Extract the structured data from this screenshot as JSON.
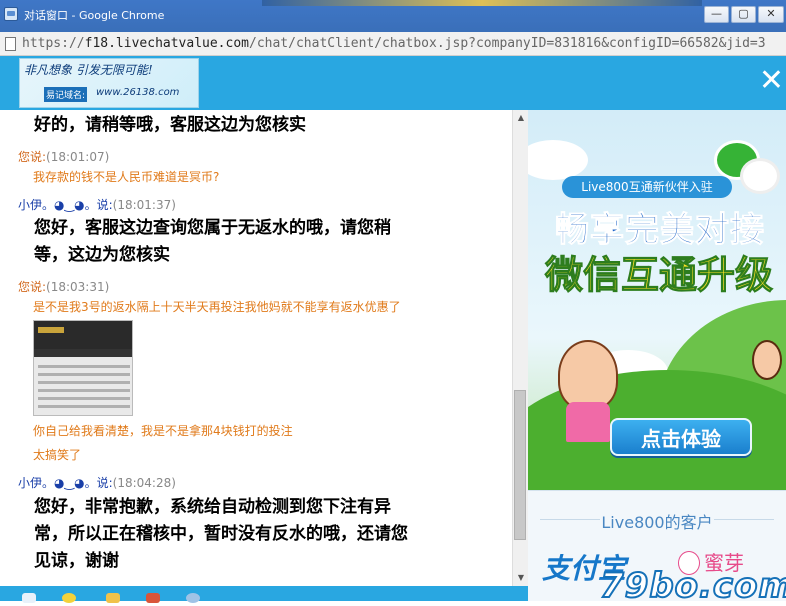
{
  "window": {
    "title": "对话窗口 - Google Chrome",
    "controls": {
      "minimize": "—",
      "maximize": "▢",
      "close": "✕"
    }
  },
  "address": {
    "url_prefix": "https://",
    "url_host": "f18.livechatvalue.com",
    "url_rest": "/chat/chatClient/chatbox.jsp?companyID=831816&configID=66582&jid=3"
  },
  "header": {
    "logo_slogan": "非凡想象  引发无限可能!",
    "logo_domain_label": "易记域名:",
    "logo_domain": "www.26138.com",
    "close_glyph": "✕"
  },
  "messages": {
    "m1_text": "好的，请稍等哦，客服这边为您核实",
    "m2_sender": "您说:",
    "m2_time": "(18:01:07)",
    "m2_text": "我存款的钱不是人民币难道是冥币?",
    "m3_sender": "小伊。◕‿◕。说:",
    "m3_time": "(18:01:37)",
    "m3_text_line1": "您好，客服这边查询您属于无返水的哦，请您稍",
    "m3_text_line2": "等，这边为您核实",
    "m4_sender": "您说:",
    "m4_time": "(18:03:31)",
    "m4_text": "是不是我3号的返水隔上十天半天再投注我他妈就不能享有返水优惠了",
    "m4_text2": "你自己给我看清楚，我是不是拿那4块钱打的投注",
    "m4_text3": "太搞笑了",
    "m5_sender": "小伊。◕‿◕。说:",
    "m5_time": "(18:04:28)",
    "m5_text_line1": "您好，非常抱歉，系统给自动检测到您下注有异",
    "m5_text_line2": "常，所以正在稽核中，暂时没有反水的哦，还请您",
    "m5_text_line3": "见谅，谢谢"
  },
  "scrollbar": {
    "up": "▲",
    "down": "▼"
  },
  "ad": {
    "badge": "Live800互通新伙伴入驻",
    "headline1": "畅享完美对接",
    "headline2": "微信互通升级",
    "cta": "点击体验"
  },
  "clients": {
    "title": "Live800的客户",
    "alipay": "支付宝",
    "miya": "蜜芽"
  },
  "watermark": "79bo.com",
  "colors": {
    "header_blue": "#29a7e1",
    "user_orange": "#e07a1a",
    "agent_blue": "#1a3fa8"
  }
}
